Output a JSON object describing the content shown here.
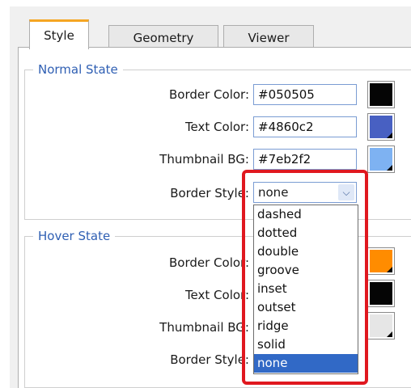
{
  "tabs": [
    {
      "label": "Style",
      "active": true
    },
    {
      "label": "Geometry",
      "active": false
    },
    {
      "label": "Viewer",
      "active": false
    }
  ],
  "normal_state": {
    "legend": "Normal State",
    "border_color": {
      "label": "Border Color:",
      "value": "#050505",
      "swatch": "#050505"
    },
    "text_color": {
      "label": "Text Color:",
      "value": "#4860c2",
      "swatch": "#4860c2"
    },
    "thumbnail_bg": {
      "label": "Thumbnail BG:",
      "value": "#7eb2f2",
      "swatch": "#7eb2f2"
    },
    "border_style": {
      "label": "Border Style:",
      "value": "none"
    }
  },
  "hover_state": {
    "legend": "Hover State",
    "border_color": {
      "label": "Border Color:",
      "swatch": "#ff8c00"
    },
    "text_color": {
      "label": "Text Color:",
      "swatch": "#050505"
    },
    "thumbnail_bg": {
      "label": "Thumbnail BG:",
      "swatch": "#e6e6e6"
    },
    "border_style": {
      "label": "Border Style:"
    }
  },
  "dropdown": {
    "options": [
      "dashed",
      "dotted",
      "double",
      "groove",
      "inset",
      "outset",
      "ridge",
      "solid",
      "none"
    ],
    "selected": "none"
  },
  "colors": {
    "tab_accent": "#f5a623",
    "legend_text": "#2f5fb3",
    "highlight_box": "#e0181f",
    "selected_option_bg": "#3169c6"
  }
}
